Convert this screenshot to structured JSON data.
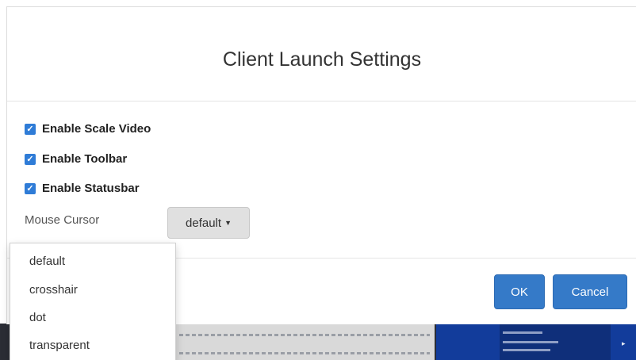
{
  "dialog": {
    "title": "Client Launch Settings",
    "options": [
      {
        "label": "Enable Scale Video",
        "checked": true
      },
      {
        "label": "Enable Toolbar",
        "checked": true
      },
      {
        "label": "Enable Statusbar",
        "checked": true
      }
    ],
    "mouse_cursor": {
      "label": "Mouse Cursor",
      "selected": "default",
      "options": [
        "default",
        "crosshair",
        "dot",
        "transparent"
      ]
    },
    "buttons": {
      "ok": "OK",
      "cancel": "Cancel"
    }
  },
  "colors": {
    "checkbox": "#2f7cd7",
    "primary_button": "#357ac8",
    "select_button": "#e0e0e0"
  },
  "icons": {
    "checkbox_checked": "checkmark-icon",
    "select_caret": "caret-down-icon"
  }
}
